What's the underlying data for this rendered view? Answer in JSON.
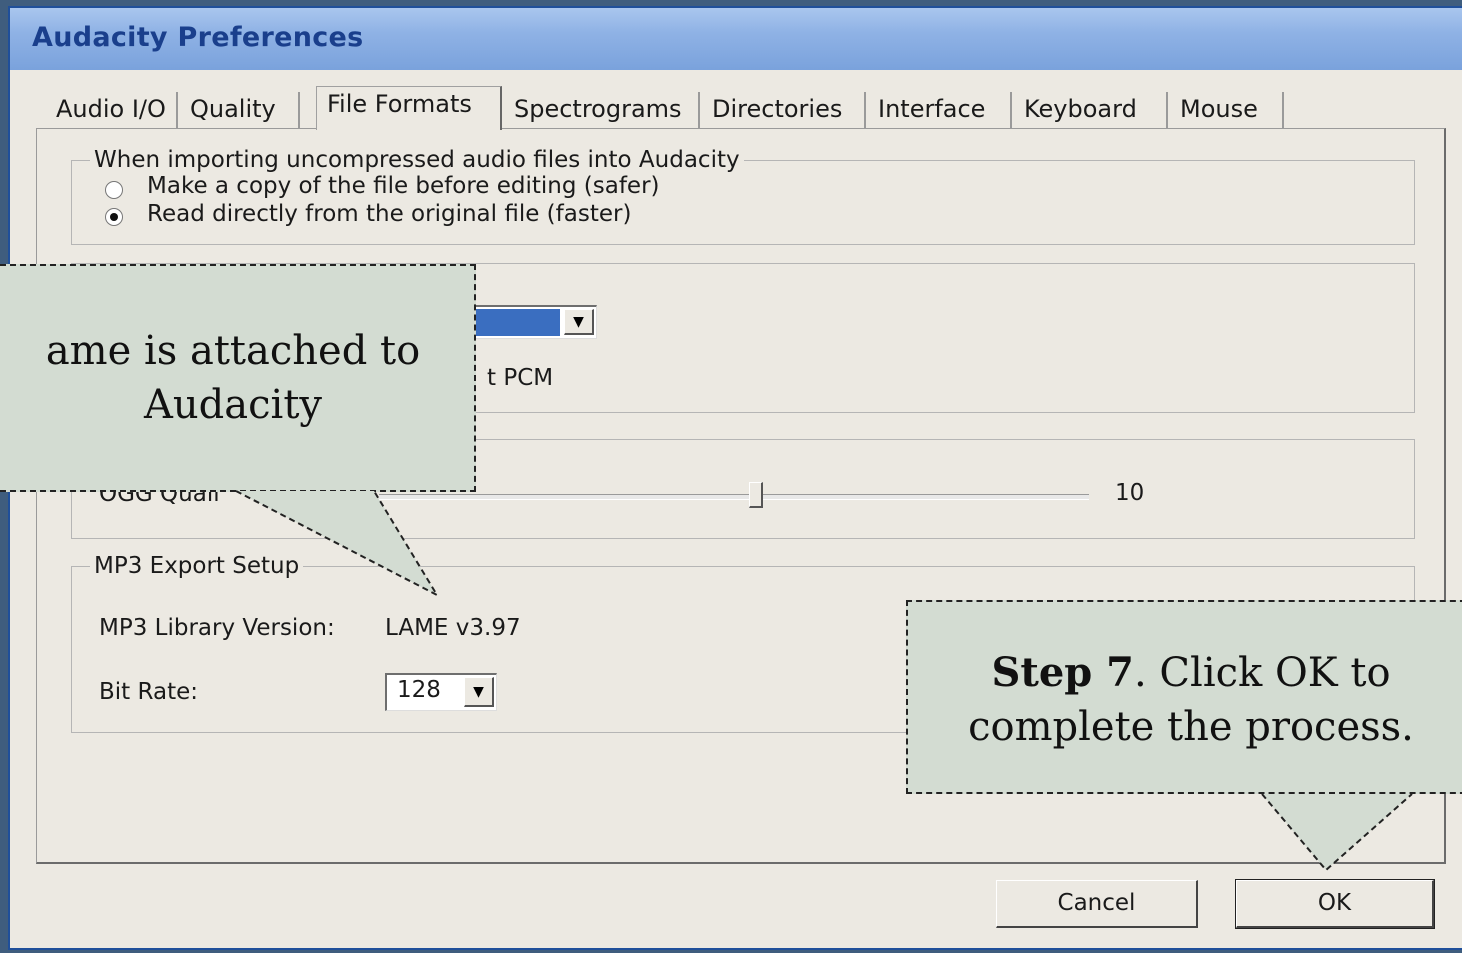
{
  "window": {
    "title": "Audacity Preferences"
  },
  "tabs": [
    {
      "label": "Audio I/O"
    },
    {
      "label": "Quality"
    },
    {
      "label": "File Formats"
    },
    {
      "label": "Spectrograms"
    },
    {
      "label": "Directories"
    },
    {
      "label": "Interface"
    },
    {
      "label": "Keyboard"
    },
    {
      "label": "Mouse"
    }
  ],
  "active_tab": "File Formats",
  "import_group": {
    "legend": "When importing uncompressed audio files into Audacity",
    "option_copy": "Make a copy of the file before editing (safer)",
    "option_direct": "Read directly from the original file (faster)",
    "selected": "option_direct"
  },
  "format_group": {
    "partial_text": "t PCM"
  },
  "ogg_group": {
    "label_partial": "OGG Quali",
    "quality_value": "10",
    "slider_level": 0.5
  },
  "mp3_group": {
    "legend": "MP3 Export Setup",
    "library_label": "MP3 Library Version:",
    "library_value": "LAME v3.97",
    "bitrate_label": "Bit Rate:",
    "bitrate_value": "128"
  },
  "buttons": {
    "cancel": "Cancel",
    "ok": "OK"
  },
  "callouts": {
    "lame": {
      "line1": "ame is attached to",
      "line2": "Audacity"
    },
    "step7": {
      "bold": "Step 7",
      "rest": ". Click OK to",
      "line2": "complete the process."
    }
  },
  "colors": {
    "titlebar": "#8fb2e5",
    "window_bg": "#ece9e2",
    "callout_bg": "#d3dcd2",
    "combo_selected": "#3a6ec0"
  }
}
